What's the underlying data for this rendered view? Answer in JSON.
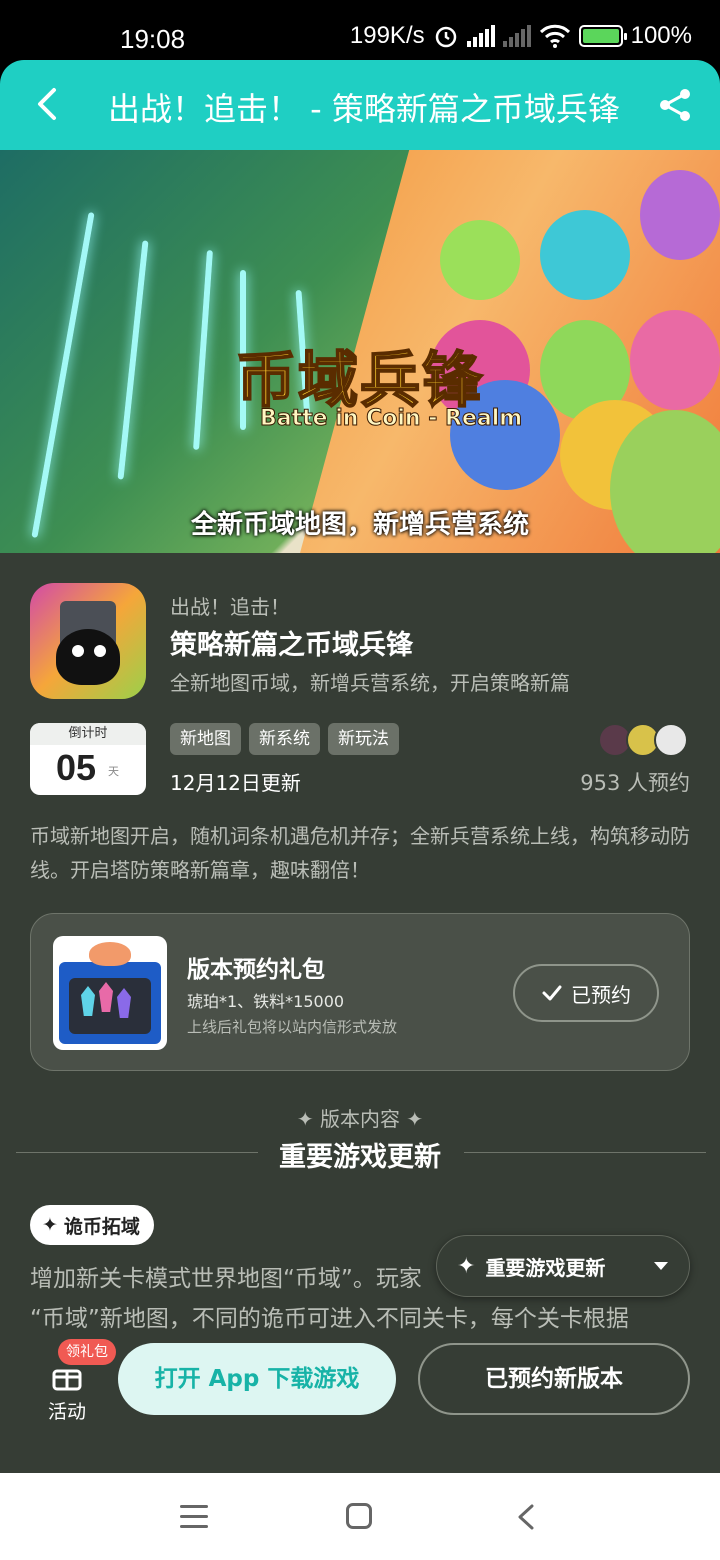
{
  "status_bar": {
    "time": "19:08",
    "speed": "199K/s",
    "battery": "100%"
  },
  "header": {
    "title": "出战！追击！ - 策略新篇之币域兵锋"
  },
  "banner": {
    "logo_title": "币域兵锋",
    "logo_subtitle": "Batte in Coin - Realm",
    "caption": "全新币域地图，新增兵营系统"
  },
  "app": {
    "subtitle": "出战！追击！",
    "title": "策略新篇之币域兵锋",
    "tagline": "全新地图币域，新增兵营系统，开启策略新篇"
  },
  "countdown": {
    "label": "倒计时",
    "value": "05",
    "unit": "天"
  },
  "tags": [
    "新地图",
    "新系统",
    "新玩法"
  ],
  "update_date": "12月12日更新",
  "reserve_count": "953 人预约",
  "description": "币域新地图开启，随机词条机遇危机并存；全新兵营系统上线，构筑移动防线。开启塔防策略新篇章，趣味翻倍！",
  "gift": {
    "title": "版本预约礼包",
    "items": "琥珀*1、铁料*15000",
    "note": "上线后礼包将以站内信形式发放",
    "button": "已预约"
  },
  "section": {
    "tag": "版本内容",
    "title": "重要游戏更新"
  },
  "chip": {
    "label": "诡币拓域"
  },
  "article": {
    "line1": "增加新关卡模式世界地图“币域”。玩家",
    "line2": "“币域”新地图，不同的诡币可进入不同关卡，每个关卡根据"
  },
  "float_toc": {
    "label": "重要游戏更新"
  },
  "bottom": {
    "activity_label": "活动",
    "activity_badge": "领礼包",
    "open_app": "打开 App 下载游戏",
    "reserved_new": "已预约新版本"
  },
  "colors": {
    "accent": "#1fcfc3",
    "background": "#363d35",
    "badge": "#f05a53"
  }
}
